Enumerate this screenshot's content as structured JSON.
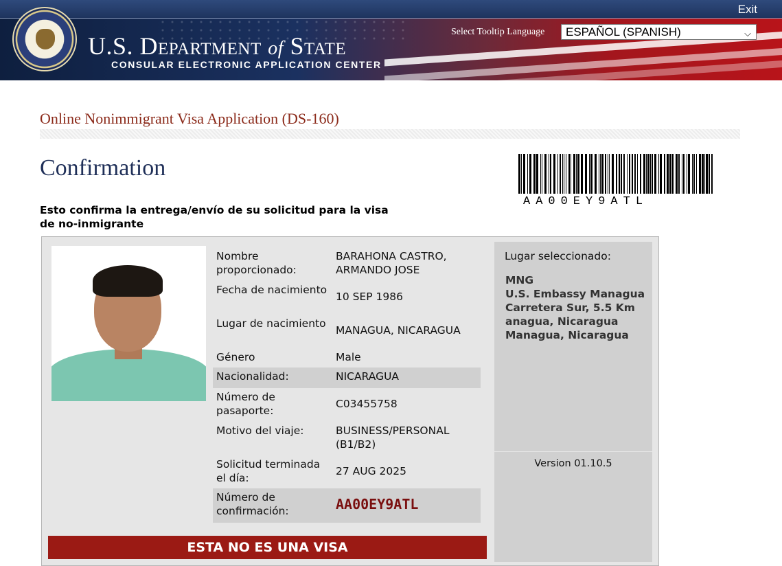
{
  "header": {
    "exit_label": "Exit",
    "dept_name_part1": "U.S. Department",
    "dept_name_of": "of",
    "dept_name_part2": "State",
    "subtitle": "CONSULAR ELECTRONIC APPLICATION CENTER",
    "tooltip_language_label": "Select Tooltip Language",
    "tooltip_language_value": "ESPAÑOL (SPANISH)",
    "colors": {
      "navy": "#1b3160",
      "red": "#b8141a"
    }
  },
  "page": {
    "app_title": "Online Nonimmigrant Visa Application (DS-160)",
    "confirmation_title": "Confirmation",
    "confirmation_subtitle": "Esto confirma la entrega/envío de su solicitud para la visa de no-inmigrante",
    "barcode_text": "AA00EY9ATL"
  },
  "applicant": {
    "photo_icon": "applicant-photo",
    "fields": [
      {
        "label": "Nombre proporcionado:",
        "value": "BARAHONA CASTRO, ARMANDO JOSE",
        "shaded": false
      },
      {
        "label": "Fecha de nacimiento",
        "value": "10 SEP 1986",
        "shaded": false
      },
      {
        "label": "Lugar de nacimiento",
        "value": "MANAGUA, NICARAGUA",
        "shaded": false
      },
      {
        "label": "Género",
        "value": "Male",
        "shaded": false
      },
      {
        "label": "Nacionalidad:",
        "value": "NICARAGUA",
        "shaded": true
      },
      {
        "label": "Número de pasaporte:",
        "value": "C03455758",
        "shaded": false
      },
      {
        "label": "Motivo del viaje:",
        "value": "BUSINESS/PERSONAL (B1/B2)",
        "shaded": false
      },
      {
        "label": "Solicitud terminada el día:",
        "value": "27 AUG 2025",
        "shaded": false
      },
      {
        "label": "Número de confirmación:",
        "value": "AA00EY9ATL",
        "shaded": true
      }
    ],
    "confirmation_color": "#7a0f0f"
  },
  "location": {
    "label": "Lugar seleccionado:",
    "lines": [
      "MNG",
      "U.S. Embassy Managua",
      "Carretera Sur, 5.5 Km",
      "anagua, Nicaragua",
      "Managua, Nicaragua"
    ]
  },
  "version": "Version 01.10.5",
  "banner": {
    "text": "ESTA NO ES UNA VISA",
    "color": "#9b1a14"
  }
}
